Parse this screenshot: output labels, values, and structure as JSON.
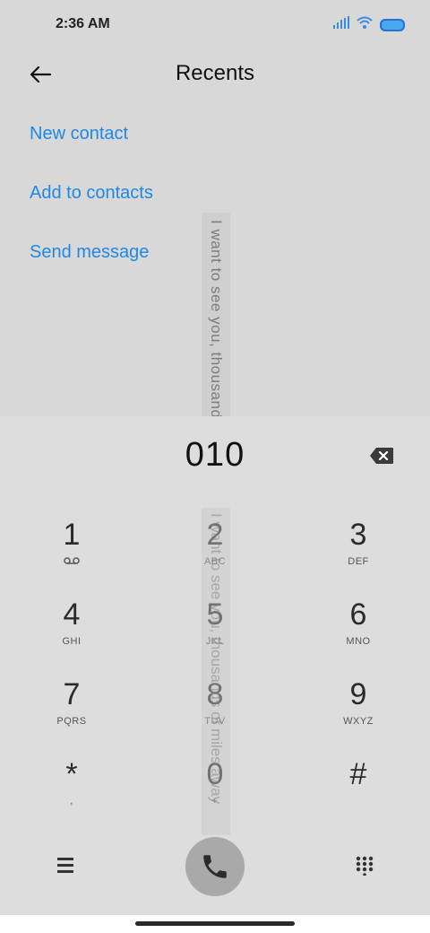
{
  "status_bar": {
    "time": "2:36 AM"
  },
  "header": {
    "title": "Recents"
  },
  "actions": [
    {
      "label": "New contact"
    },
    {
      "label": "Add to contacts"
    },
    {
      "label": "Send message"
    }
  ],
  "banner": {
    "text": "I want to see you, thousands of miles away"
  },
  "dialpad": {
    "number": "010",
    "keys": [
      {
        "digit": "1",
        "letters": ""
      },
      {
        "digit": "2",
        "letters": "ABC"
      },
      {
        "digit": "3",
        "letters": "DEF"
      },
      {
        "digit": "4",
        "letters": "GHI"
      },
      {
        "digit": "5",
        "letters": "JKL"
      },
      {
        "digit": "6",
        "letters": "MNO"
      },
      {
        "digit": "7",
        "letters": "PQRS"
      },
      {
        "digit": "8",
        "letters": "TUV"
      },
      {
        "digit": "9",
        "letters": "WXYZ"
      },
      {
        "digit": "*",
        "letters": ","
      },
      {
        "digit": "0",
        "letters": "+"
      },
      {
        "digit": "#",
        "letters": ""
      }
    ]
  },
  "colors": {
    "accent": "#1e88e5",
    "call_button": "#a9a9a9"
  }
}
